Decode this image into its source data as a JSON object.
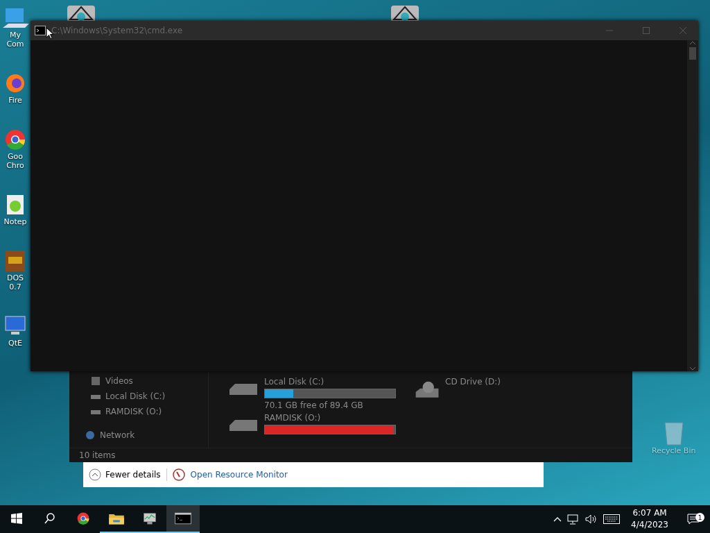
{
  "desktop_icons": [
    {
      "kind": "computer",
      "lines": [
        "My Com"
      ]
    },
    {
      "kind": "firefox",
      "lines": [
        "Fire"
      ]
    },
    {
      "kind": "chrome",
      "lines": [
        "Goo",
        "Chro"
      ]
    },
    {
      "kind": "notepad",
      "lines": [
        "Notep"
      ]
    },
    {
      "kind": "dos",
      "lines": [
        "DOS",
        "0.7"
      ]
    },
    {
      "kind": "monitor",
      "lines": [
        "QtE"
      ]
    }
  ],
  "recycle_bin": {
    "label": "Recycle Bin"
  },
  "explorer": {
    "sidebar": [
      {
        "kind": "videos",
        "label": "Videos"
      },
      {
        "kind": "disk",
        "label": "Local Disk (C:)"
      },
      {
        "kind": "disk",
        "label": "RAMDISK (O:)"
      },
      {
        "kind": "network",
        "label": "Network"
      }
    ],
    "drives": [
      {
        "kind": "disk",
        "name": "Local Disk (C:)",
        "level": 0.22,
        "color": "#26a0da",
        "free": "70.1 GB free of 89.4 GB"
      },
      {
        "kind": "cd",
        "name": "CD Drive (D:)"
      },
      {
        "kind": "disk",
        "name": "RAMDISK (O:)",
        "level": 0.99,
        "color": "#da2626"
      }
    ],
    "status": "10 items"
  },
  "cmd_window": {
    "title": "C:\\Windows\\System32\\cmd.exe"
  },
  "task_manager": {
    "fewer_details": "Fewer details",
    "resource_monitor": "Open Resource Monitor"
  },
  "taskbar": {
    "apps": [
      {
        "kind": "chrome",
        "running": false,
        "active": false
      },
      {
        "kind": "explorer",
        "running": true,
        "active": false
      },
      {
        "kind": "taskmgr",
        "running": true,
        "active": false
      },
      {
        "kind": "cmd",
        "running": true,
        "active": true
      }
    ],
    "time": "6:07 AM",
    "date": "4/4/2023",
    "notifications": "1"
  }
}
